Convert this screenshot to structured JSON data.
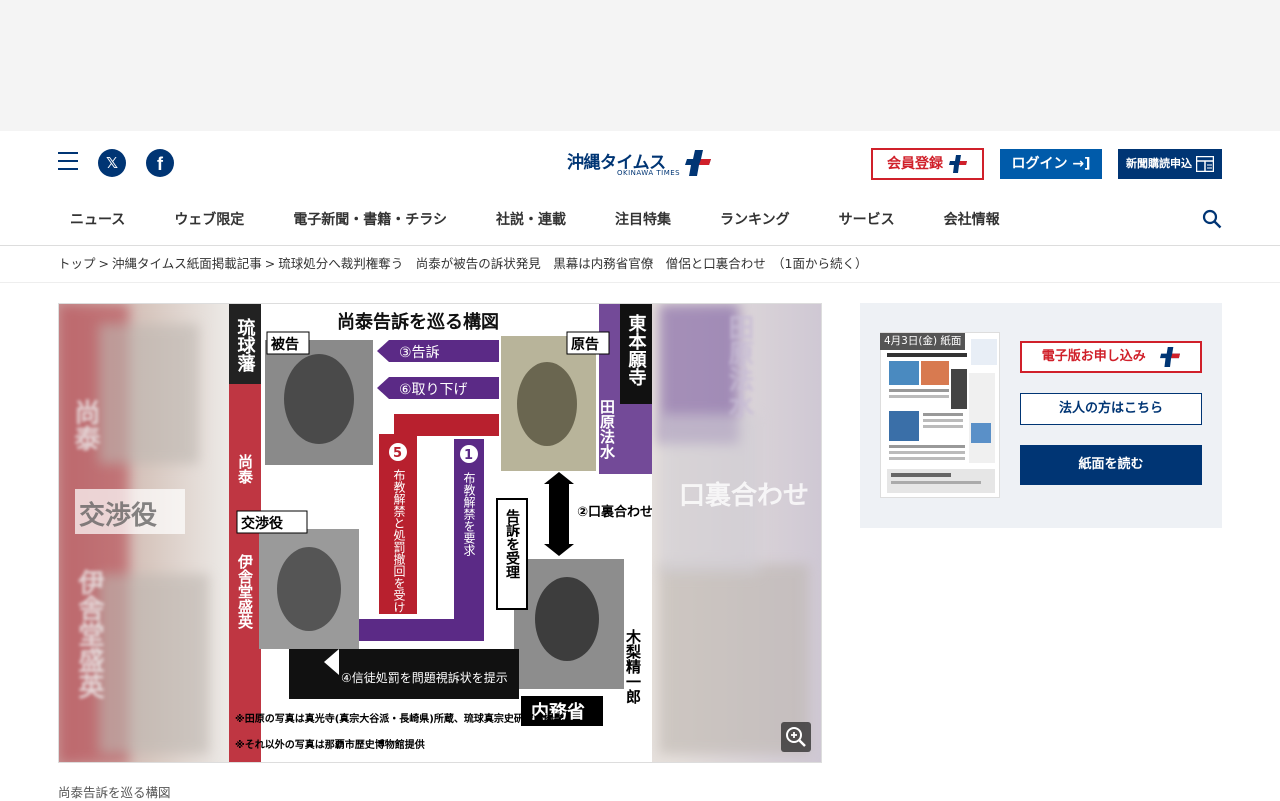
{
  "header": {
    "logo_text": "沖縄タイムス",
    "logo_sub": "OKINAWA TIMES",
    "member_label": "会員登録",
    "login_label": "ログイン",
    "subscribe_label": "新聞購読申込"
  },
  "nav": {
    "items": [
      "ニュース",
      "ウェブ限定",
      "電子新聞・書籍・チラシ",
      "社説・連載",
      "注目特集",
      "ランキング",
      "サービス",
      "会社情報"
    ]
  },
  "breadcrumb": {
    "home": "トップ",
    "section": "沖縄タイムス紙面掲載記事",
    "current": "琉球処分へ裁判権奪う　尚泰が被告の訴状発見　黒幕は内務省官僚　僧侶と口裏合わせ　（1面から続く）"
  },
  "figure": {
    "title": "尚泰告訴を巡る構図",
    "left_label": "琉球藩",
    "right_label": "東本願寺",
    "defendant_tag": "被告",
    "defendant_name": "尚泰",
    "negotiator_tag": "交渉役",
    "negotiator_name": "伊舎堂盛英",
    "plaintiff_tag": "原告",
    "plaintiff_name": "田原法水",
    "arrow3": "③告訴",
    "arrow6": "⑥取り下げ",
    "arrow5_num": "5",
    "arrow5": "布教解禁と処罰撤回を受け入れる",
    "arrow1_num": "1",
    "arrow1": "布教解禁を要求",
    "arrow2": "②口裏合わせ",
    "accept": "告訴を受理",
    "official_name": "木梨精一郎",
    "ministry": "内務省",
    "arrow4": "④信徒処罰を問題視訴状を提示",
    "note1": "※田原の写真は真光寺(真宗大谷派・長崎県)所蔵、琉球真宗史研究会撮影",
    "note2": "※それ以外の写真は那覇市歴史博物館提供",
    "bg_left_1": "尚泰",
    "bg_left_2": "交渉役",
    "bg_left_3": "伊舎堂盛英",
    "bg_right_1": "田原法水",
    "bg_right_2": "口裏合わせ",
    "caption": "尚泰告訴を巡る構図"
  },
  "sidebar": {
    "paper_date": "4月3日(金) 紙面",
    "btn_digital": "電子版お申し込み",
    "btn_corporate": "法人の方はこちら",
    "btn_read": "紙面を読む"
  },
  "colors": {
    "brand_navy": "#003574",
    "brand_blue": "#005baa",
    "brand_red": "#d0202a",
    "diagram_purple": "#5b2a86",
    "diagram_red": "#b8202e"
  }
}
